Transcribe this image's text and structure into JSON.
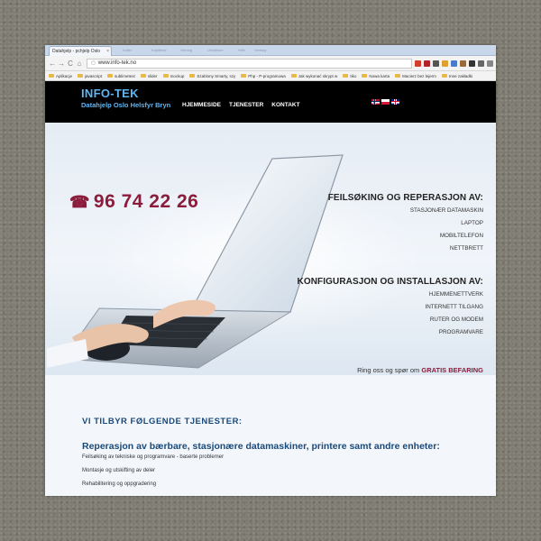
{
  "browser": {
    "tab_title": "Datahjelp - pchjelp Oslo",
    "tab_close": "×",
    "other_tabs": [
      "Kaller",
      "Kapitlene",
      "Visning",
      "Utvidelser",
      "Hilfe",
      "Verktøy"
    ],
    "nav": {
      "back": "←",
      "forward": "→",
      "reload": "C",
      "home": "⌂"
    },
    "url": "www.info-tek.no",
    "bookmarks": [
      "Aplikacje",
      "javascript",
      "sublimetext",
      "slider",
      "mockup",
      "Szablony Smarty, szy",
      "Php - P-programowa",
      "Jak wykonać skrypt w",
      "tiko",
      "Nowa karta",
      "Macierz bez lejerm",
      "Inne zakładki"
    ],
    "ext_colors": [
      "#d43c2c",
      "#b2222a",
      "#555555",
      "#e0a030",
      "#4a7bc8",
      "#9a6a3a",
      "#333333",
      "#666666",
      "#888888"
    ]
  },
  "header": {
    "title": "INFO-TEK",
    "subtitle": "Datahjelp Oslo Helsfyr Bryn",
    "nav": [
      "HJEMMESIDE",
      "TJENESTER",
      "KONTAKT"
    ],
    "flags": [
      "norsk",
      "polski",
      "english"
    ]
  },
  "hero": {
    "phone_icon": "☎",
    "phone": "96 74 22 26",
    "section1": {
      "heading": "FEILSØKING OG REPERASJON AV:",
      "items": [
        "STASJONÆR DATAMASKIN",
        "LAPTOP",
        "MOBILTELEFON",
        "NETTBRETT"
      ]
    },
    "section2": {
      "heading": "KONFIGURASJON OG INSTALLASJON AV:",
      "items": [
        "HJEMMENETTVERK",
        "INTERNETT TILGANG",
        "RUTER OG MODEM",
        "PROGRAMVARE"
      ]
    },
    "cta_text": "Ring oss og spør om",
    "cta_strong": "GRATIS BEFARING"
  },
  "content": {
    "heading": "VI TILBYR FØLGENDE TJENESTER:",
    "subheading": "Reperasjon av bærbare, stasjonære datamaskiner, printere samt andre enheter:",
    "items": [
      "Feilsøking av tekniske og programvare - baserte problemer",
      "Montasje og utskifting av deler",
      "Rehabilitering og oppgradering"
    ]
  },
  "colors": {
    "brand_blue": "#5fb5f0",
    "accent": "#8b1c3b",
    "heading_blue": "#1a4a7a",
    "header_bg": "#000000"
  }
}
